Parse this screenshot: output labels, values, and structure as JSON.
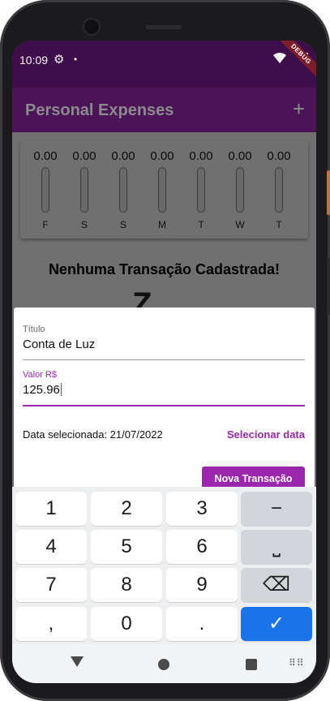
{
  "status": {
    "time": "10:09",
    "gear_icon": "⚙",
    "dot": "•",
    "debug_banner": "DEBUG"
  },
  "appbar": {
    "title": "Personal Expenses",
    "add_icon": "+"
  },
  "chart": {
    "days": [
      {
        "value": "0.00",
        "label": "F",
        "fill": 0
      },
      {
        "value": "0.00",
        "label": "S",
        "fill": 0
      },
      {
        "value": "0.00",
        "label": "S",
        "fill": 0
      },
      {
        "value": "0.00",
        "label": "M",
        "fill": 0
      },
      {
        "value": "0.00",
        "label": "T",
        "fill": 0
      },
      {
        "value": "0.00",
        "label": "W",
        "fill": 0
      },
      {
        "value": "0.00",
        "label": "T",
        "fill": 0
      }
    ]
  },
  "empty_state": {
    "message": "Nenhuma Transação Cadastrada!",
    "partial_glyph": "Z"
  },
  "form": {
    "title_label": "Título",
    "title_value": "Conta de Luz",
    "value_label": "Valor R$",
    "value_value": "125.96",
    "date_text": "Data selecionada: 21/07/2022",
    "select_date_label": "Selecionar data",
    "submit_label": "Nova Transação"
  },
  "keyboard": {
    "rows": [
      [
        "1",
        "2",
        "3",
        "−"
      ],
      [
        "4",
        "5",
        "6",
        "⎵"
      ],
      [
        "7",
        "8",
        "9",
        "⌫"
      ],
      [
        ",",
        "0",
        ".",
        "✓"
      ]
    ]
  },
  "navbar": {
    "keyboard_icon": "⠿⠿"
  },
  "colors": {
    "accent": "#9b27af",
    "appbar": "#4a1456",
    "statusbar": "#3e0e4a",
    "enter_key": "#1a73e8"
  }
}
